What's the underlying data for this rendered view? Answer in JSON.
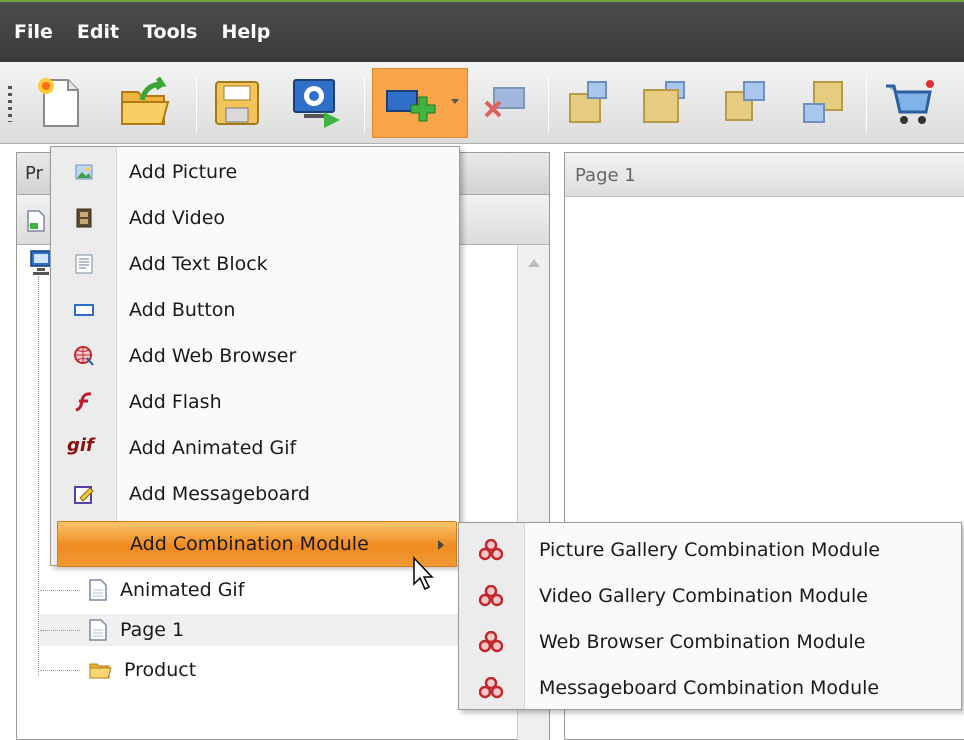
{
  "menubar": {
    "items": [
      "File",
      "Edit",
      "Tools",
      "Help"
    ]
  },
  "toolbar": {
    "buttons": [
      {
        "icon": "new-page-icon"
      },
      {
        "icon": "open-folder-icon"
      },
      {
        "icon": "save-icon"
      },
      {
        "icon": "preview-icon"
      },
      {
        "icon": "add-module-icon",
        "active": true
      },
      {
        "icon": "delete-module-icon"
      },
      {
        "icon": "bring-front-icon"
      },
      {
        "icon": "send-back-icon"
      },
      {
        "icon": "bring-forward-icon"
      },
      {
        "icon": "send-backward-icon"
      },
      {
        "icon": "cart-icon"
      }
    ]
  },
  "left_panel": {
    "title_partial": "Pr"
  },
  "page_panel": {
    "tab": "Page 1"
  },
  "tree": {
    "items": [
      {
        "label": "Animated Gif",
        "icon": "page-icon"
      },
      {
        "label": "Page 1",
        "icon": "page-icon"
      },
      {
        "label": "Product",
        "icon": "folder-icon"
      }
    ]
  },
  "menu": {
    "items": [
      {
        "label": "Add Picture",
        "icon": "picture-icon"
      },
      {
        "label": "Add Video",
        "icon": "video-icon"
      },
      {
        "label": "Add Text Block",
        "icon": "text-block-icon"
      },
      {
        "label": "Add Button",
        "icon": "button-icon"
      },
      {
        "label": "Add Web Browser",
        "icon": "web-browser-icon"
      },
      {
        "label": "Add Flash",
        "icon": "flash-icon"
      },
      {
        "label": "Add Animated Gif",
        "icon": "gif-icon",
        "glyph": "gif"
      },
      {
        "label": "Add Messageboard",
        "icon": "messageboard-icon"
      },
      {
        "label": "Add Combination Module",
        "icon": "",
        "highlighted": true
      }
    ]
  },
  "submenu": {
    "items": [
      {
        "label": "Picture Gallery Combination Module",
        "icon": "combination-module-icon"
      },
      {
        "label": "Video Gallery Combination Module",
        "icon": "combination-module-icon"
      },
      {
        "label": "Web Browser Combination Module",
        "icon": "combination-module-icon"
      },
      {
        "label": "Messageboard Combination Module",
        "icon": "combination-module-icon"
      }
    ]
  },
  "colors": {
    "highlight": "#f08a20",
    "accent": "#6fa63d",
    "combo_icon": "#c0282d"
  }
}
